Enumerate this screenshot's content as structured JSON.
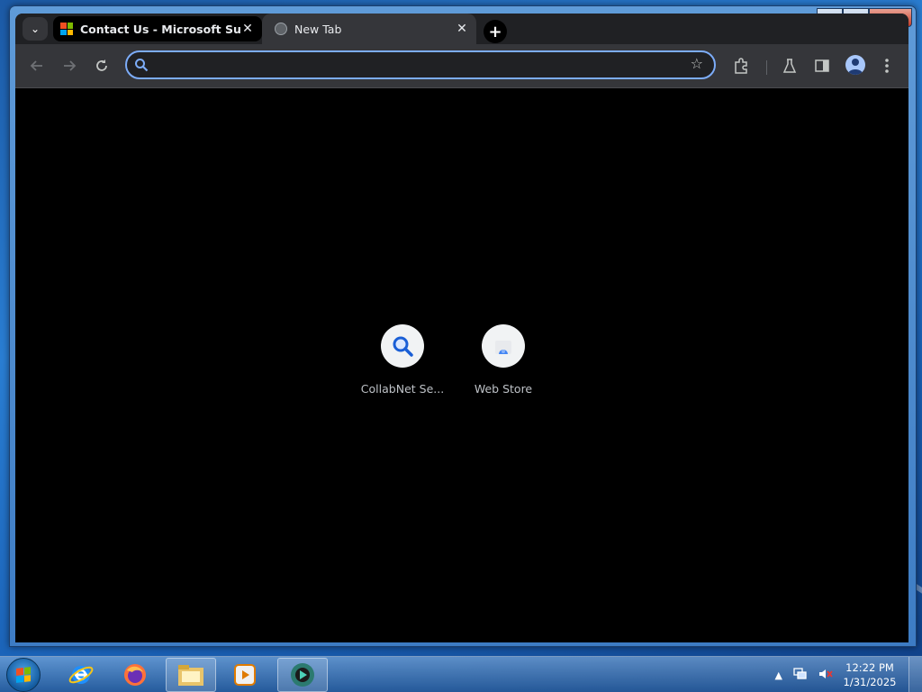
{
  "browser": {
    "tabs": [
      {
        "title": "Contact Us - Microsoft Suppor",
        "favicon": "microsoft-logo",
        "active": false
      },
      {
        "title": "New Tab",
        "favicon": "globe-icon",
        "active": true
      }
    ],
    "omnibox": {
      "value": "",
      "placeholder": ""
    },
    "toolbar_icons": [
      "back-icon",
      "forward-icon",
      "reload-icon",
      "star-icon",
      "extensions-icon",
      "labs-icon",
      "side-panel-icon",
      "profile-icon",
      "menu-icon"
    ]
  },
  "new_tab": {
    "shortcuts": [
      {
        "label": "CollabNet Se...",
        "icon": "search-icon"
      },
      {
        "label": "Web Store",
        "icon": "web-store-icon"
      }
    ]
  },
  "taskbar": {
    "apps": [
      "internet-explorer-icon",
      "firefox-icon",
      "file-explorer-icon",
      "media-player-icon",
      "chrome-app-icon"
    ],
    "clock": {
      "time": "12:22 PM",
      "date": "1/31/2025"
    }
  },
  "colors": {
    "accent": "#7cacf8",
    "page_bg": "#000000",
    "toolbar_bg": "#35363a"
  }
}
